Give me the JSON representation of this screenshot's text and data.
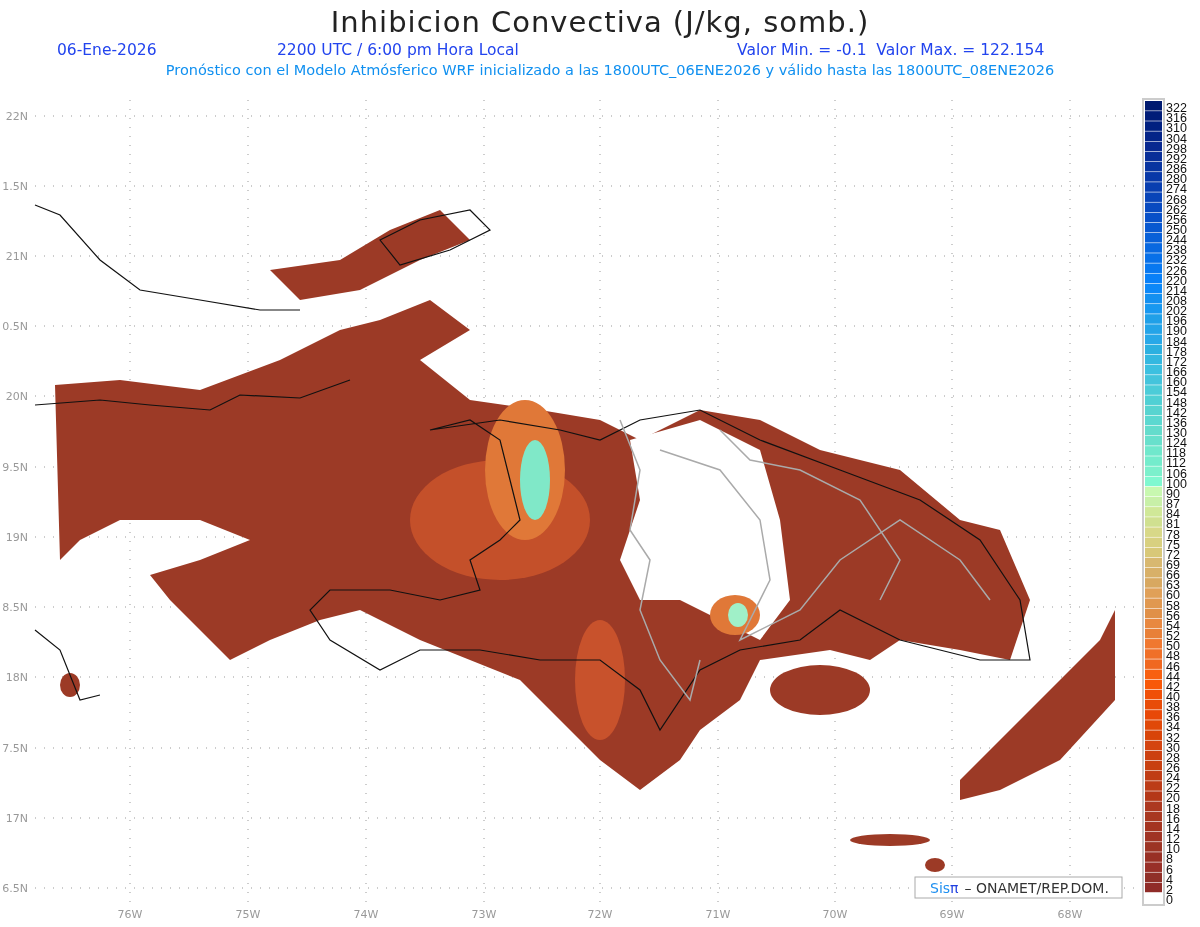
{
  "title": "Inhibicion Convectiva (J/kg, somb.)",
  "header": {
    "date": "06-Ene-2026",
    "time": "2200 UTC / 6:00 pm Hora Local",
    "min_max": "Valor Min. = -0.1  Valor Max. = 122.154"
  },
  "subtitle": "Pronóstico con el Modelo Atmósferico WRF inicializado a las 1800UTC_06ENE2026 y válido hasta las 1800UTC_08ENE2026",
  "map": {
    "y_axis_labels": [
      "22N",
      "1.5N",
      "21N",
      "0.5N",
      "20N",
      "9.5N",
      "19N",
      "8.5N",
      "18N",
      "7.5N",
      "17N",
      "6.5N"
    ],
    "x_axis_labels": [
      "76W",
      "75W",
      "74W",
      "73W",
      "72W",
      "71W",
      "70W",
      "69W",
      "68W"
    ],
    "credit": {
      "logo": "Sis",
      "logo_symbol": "π",
      "text": "– ONAMET/REP.DOM."
    }
  },
  "colorbar": [
    {
      "label": "322",
      "color": "#001a70"
    },
    {
      "label": "316",
      "color": "#001c78"
    },
    {
      "label": "310",
      "color": "#002080"
    },
    {
      "label": "304",
      "color": "#042488"
    },
    {
      "label": "298",
      "color": "#082890"
    },
    {
      "label": "292",
      "color": "#082e98"
    },
    {
      "label": "286",
      "color": "#0834a0"
    },
    {
      "label": "280",
      "color": "#0838a8"
    },
    {
      "label": "274",
      "color": "#083eb0"
    },
    {
      "label": "268",
      "color": "#0844b8"
    },
    {
      "label": "262",
      "color": "#084ac0"
    },
    {
      "label": "256",
      "color": "#0850c8"
    },
    {
      "label": "250",
      "color": "#0858d0"
    },
    {
      "label": "244",
      "color": "#0860d8"
    },
    {
      "label": "238",
      "color": "#0868e0"
    },
    {
      "label": "232",
      "color": "#0870e8"
    },
    {
      "label": "226",
      "color": "#0878f0"
    },
    {
      "label": "220",
      "color": "#0880f8"
    },
    {
      "label": "214",
      "color": "#0c88f8"
    },
    {
      "label": "208",
      "color": "#1490f0"
    },
    {
      "label": "202",
      "color": "#1898f0"
    },
    {
      "label": "196",
      "color": "#20a0e8"
    },
    {
      "label": "190",
      "color": "#24a4e8"
    },
    {
      "label": "184",
      "color": "#28a8e8"
    },
    {
      "label": "178",
      "color": "#2cb0e0"
    },
    {
      "label": "172",
      "color": "#34b8e0"
    },
    {
      "label": "166",
      "color": "#3cc0e0"
    },
    {
      "label": "160",
      "color": "#44c4dc"
    },
    {
      "label": "154",
      "color": "#4cccd8"
    },
    {
      "label": "148",
      "color": "#50d0d4"
    },
    {
      "label": "142",
      "color": "#58d4d0"
    },
    {
      "label": "136",
      "color": "#5cd8d0"
    },
    {
      "label": "130",
      "color": "#64dccc"
    },
    {
      "label": "124",
      "color": "#68e0cc"
    },
    {
      "label": "118",
      "color": "#70e8cc"
    },
    {
      "label": "112",
      "color": "#74eccc"
    },
    {
      "label": "106",
      "color": "#7cf0cc"
    },
    {
      "label": "100",
      "color": "#80f8d0"
    },
    {
      "label": "90",
      "color": "#c8f8b0"
    },
    {
      "label": "87",
      "color": "#c8f0a8"
    },
    {
      "label": "84",
      "color": "#d0e898"
    },
    {
      "label": "81",
      "color": "#d0e090"
    },
    {
      "label": "78",
      "color": "#d8d888"
    },
    {
      "label": "75",
      "color": "#d8d080"
    },
    {
      "label": "72",
      "color": "#d8c878"
    },
    {
      "label": "69",
      "color": "#d8b870"
    },
    {
      "label": "66",
      "color": "#d8b068"
    },
    {
      "label": "63",
      "color": "#d8a860"
    },
    {
      "label": "60",
      "color": "#e0a058"
    },
    {
      "label": "58",
      "color": "#e09850"
    },
    {
      "label": "56",
      "color": "#e09048"
    },
    {
      "label": "54",
      "color": "#e88840"
    },
    {
      "label": "52",
      "color": "#e88038"
    },
    {
      "label": "50",
      "color": "#f07830"
    },
    {
      "label": "48",
      "color": "#f07028"
    },
    {
      "label": "46",
      "color": "#f06820"
    },
    {
      "label": "44",
      "color": "#f86010"
    },
    {
      "label": "42",
      "color": "#f85808"
    },
    {
      "label": "40",
      "color": "#f05008"
    },
    {
      "label": "38",
      "color": "#e84c08"
    },
    {
      "label": "36",
      "color": "#e84808"
    },
    {
      "label": "34",
      "color": "#e04808"
    },
    {
      "label": "32",
      "color": "#d84408"
    },
    {
      "label": "30",
      "color": "#d44410"
    },
    {
      "label": "28",
      "color": "#cc4010"
    },
    {
      "label": "26",
      "color": "#c84010"
    },
    {
      "label": "24",
      "color": "#c03c14"
    },
    {
      "label": "22",
      "color": "#bc3c18"
    },
    {
      "label": "20",
      "color": "#b43818"
    },
    {
      "label": "18",
      "color": "#ac3820"
    },
    {
      "label": "16",
      "color": "#a83820"
    },
    {
      "label": "14",
      "color": "#a43420"
    },
    {
      "label": "12",
      "color": "#a03424"
    },
    {
      "label": "10",
      "color": "#9c3424"
    },
    {
      "label": "8",
      "color": "#983024"
    },
    {
      "label": "6",
      "color": "#983028"
    },
    {
      "label": "4",
      "color": "#903028"
    },
    {
      "label": "2",
      "color": "#902c28"
    },
    {
      "label": "0",
      "color": "#ffffff"
    }
  ]
}
